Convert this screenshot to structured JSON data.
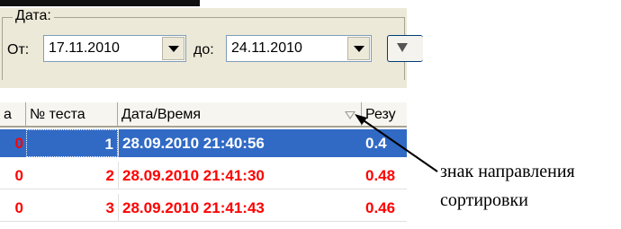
{
  "filter": {
    "group_label": "Дата:",
    "from_label": "От:",
    "from_value": "17.11.2010",
    "to_label": "до:",
    "to_value": "24.11.2010"
  },
  "grid": {
    "columns": [
      "а",
      "№ теста",
      "Дата/Время",
      "Резу"
    ],
    "rows": [
      {
        "number": "1",
        "datetime": "28.09.2010 21:40:56",
        "result": "0.4",
        "selected": true
      },
      {
        "number": "2",
        "datetime": "28.09.2010 21:41:30",
        "result": "0.48",
        "selected": false
      },
      {
        "number": "3",
        "datetime": "28.09.2010 21:41:43",
        "result": "0.46",
        "selected": false
      }
    ]
  },
  "annotation": {
    "line1": "знак направления",
    "line2": "сортировки"
  },
  "colors": {
    "selection": "#316ac5",
    "row_text": "#ff0000"
  }
}
